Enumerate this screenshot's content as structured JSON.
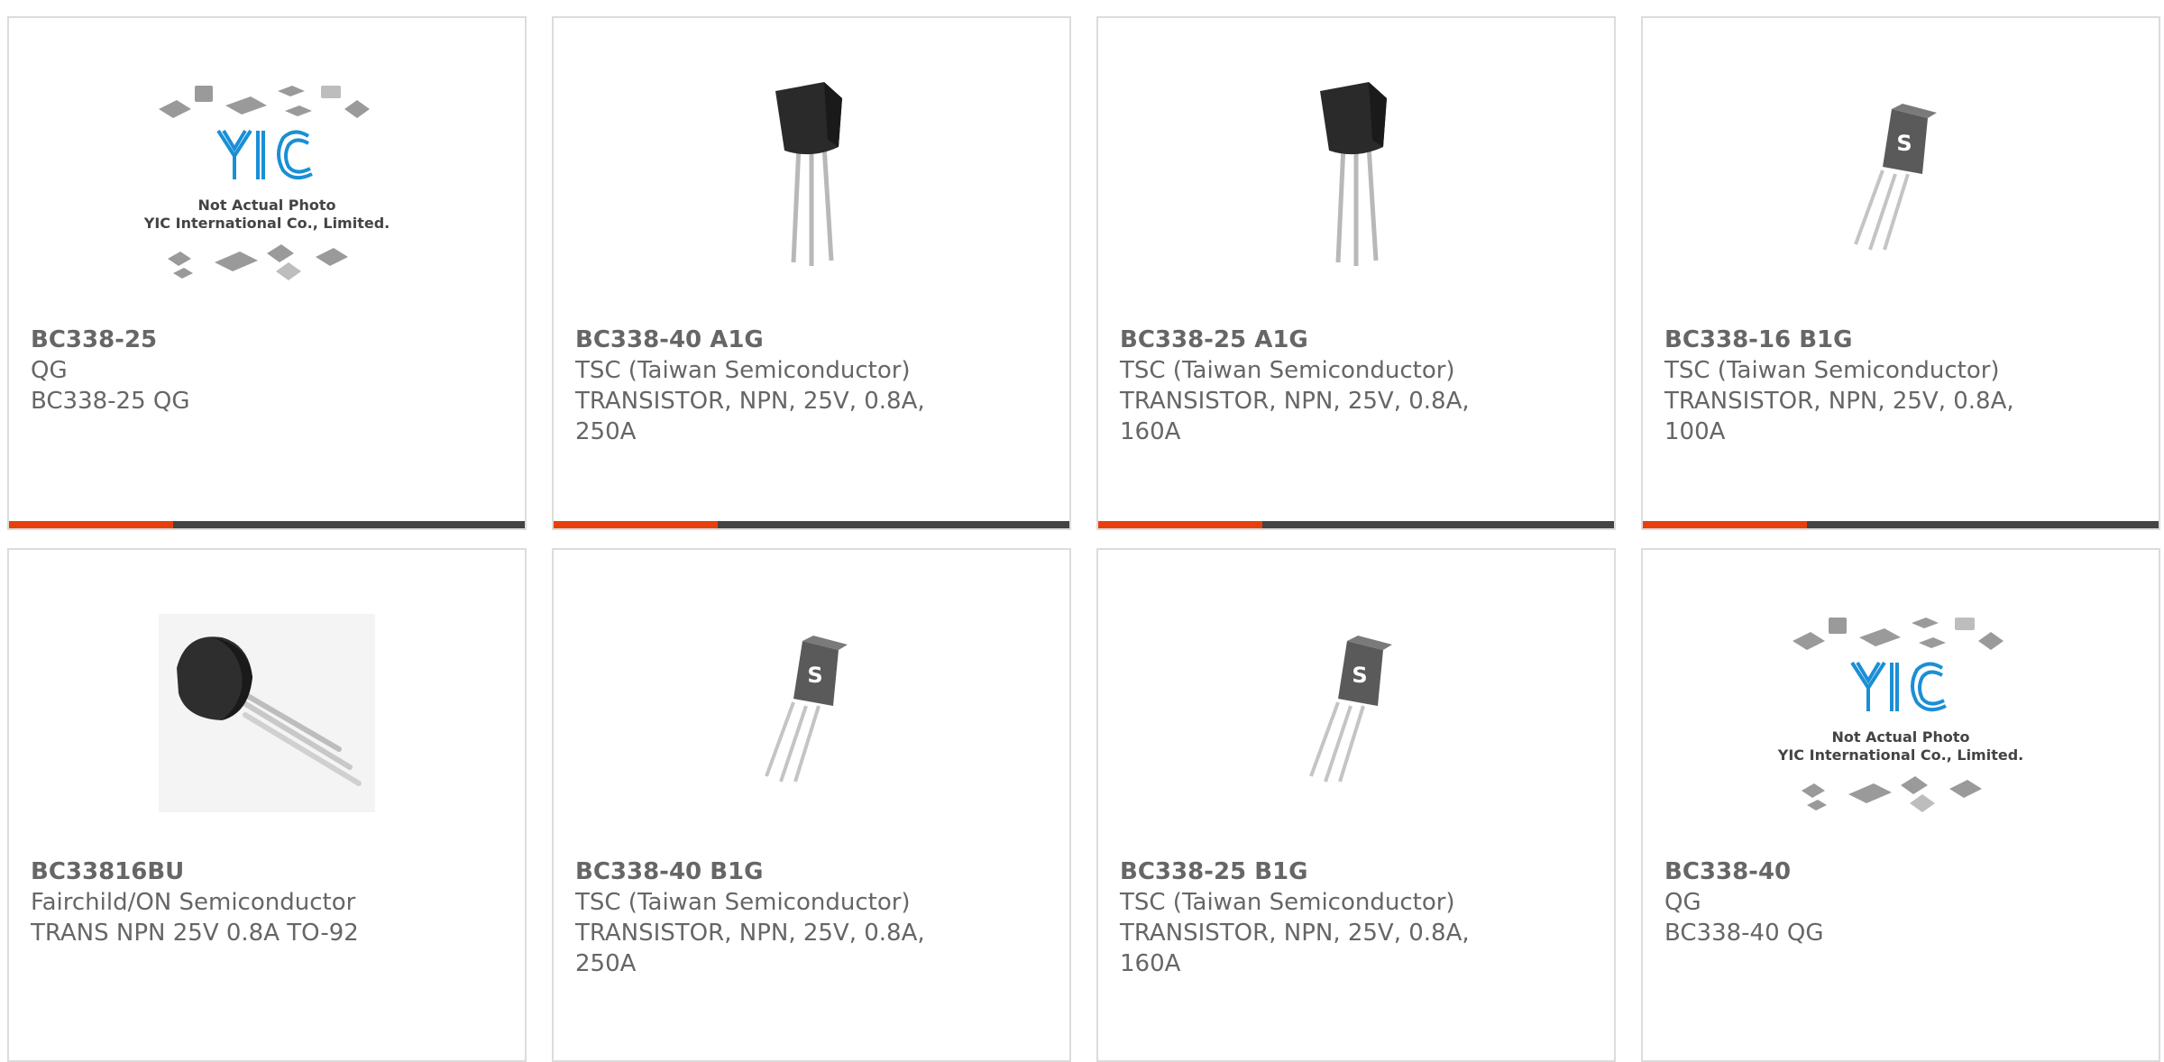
{
  "products": [
    {
      "part_number": "BC338-25",
      "manufacturer": "QG",
      "description": "BC338-25 QG",
      "image": "yic-placeholder",
      "placeholder_lines": [
        "Not Actual Photo",
        "YIC International Co., Limited."
      ]
    },
    {
      "part_number": "BC338-40 A1G",
      "manufacturer": "TSC (Taiwan Semiconductor)",
      "description": "TRANSISTOR, NPN, 25V, 0.8A, 250A",
      "image": "to92-transistor-black"
    },
    {
      "part_number": "BC338-25 A1G",
      "manufacturer": "TSC (Taiwan Semiconductor)",
      "description": "TRANSISTOR, NPN, 25V, 0.8A, 160A",
      "image": "to92-transistor-black"
    },
    {
      "part_number": "BC338-16 B1G",
      "manufacturer": "TSC (Taiwan Semiconductor)",
      "description": "TRANSISTOR, NPN, 25V, 0.8A, 100A",
      "image": "to92-transistor-gray-logo"
    },
    {
      "part_number": "BC33816BU",
      "manufacturer": "Fairchild/ON Semiconductor",
      "description": "TRANS NPN 25V 0.8A TO-92",
      "image": "to92-transistor-side"
    },
    {
      "part_number": "BC338-40 B1G",
      "manufacturer": "TSC (Taiwan Semiconductor)",
      "description": "TRANSISTOR, NPN, 25V, 0.8A, 250A",
      "image": "to92-transistor-gray-logo"
    },
    {
      "part_number": "BC338-25 B1G",
      "manufacturer": "TSC (Taiwan Semiconductor)",
      "description": "TRANSISTOR, NPN, 25V, 0.8A, 160A",
      "image": "to92-transistor-gray-logo"
    },
    {
      "part_number": "BC338-40",
      "manufacturer": "QG",
      "description": "BC338-40 QG",
      "image": "yic-placeholder",
      "placeholder_lines": [
        "Not Actual Photo",
        "YIC International Co., Limited."
      ]
    }
  ],
  "colors": {
    "accent": "#e8400c",
    "bar": "#444444",
    "text": "#666666",
    "border": "#dcdcdc",
    "yic_blue": "#1a8fd6"
  }
}
